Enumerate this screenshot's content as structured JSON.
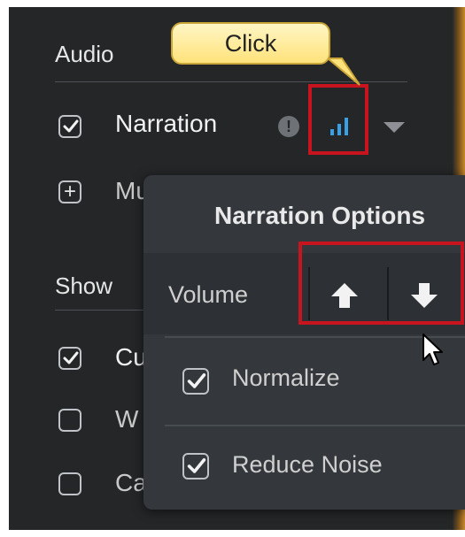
{
  "callout": {
    "text": "Click"
  },
  "audio": {
    "title": "Audio",
    "narration_label": "Narration",
    "narration_checked": true,
    "music_label_partial": "Mu"
  },
  "show": {
    "title": "Show",
    "rows": [
      {
        "label": "Cu",
        "checked": true
      },
      {
        "label": "W",
        "checked": false
      },
      {
        "label": "Ca",
        "checked": false
      }
    ]
  },
  "popup": {
    "title": "Narration Options",
    "volume_label": "Volume",
    "normalize_label": "Normalize",
    "normalize_checked": true,
    "reduce_noise_label": "Reduce Noise",
    "reduce_noise_checked": true
  },
  "colors": {
    "accent_blue": "#3aa0e6",
    "highlight_red": "#c8141e",
    "callout_yellow": "#ffe27a"
  }
}
